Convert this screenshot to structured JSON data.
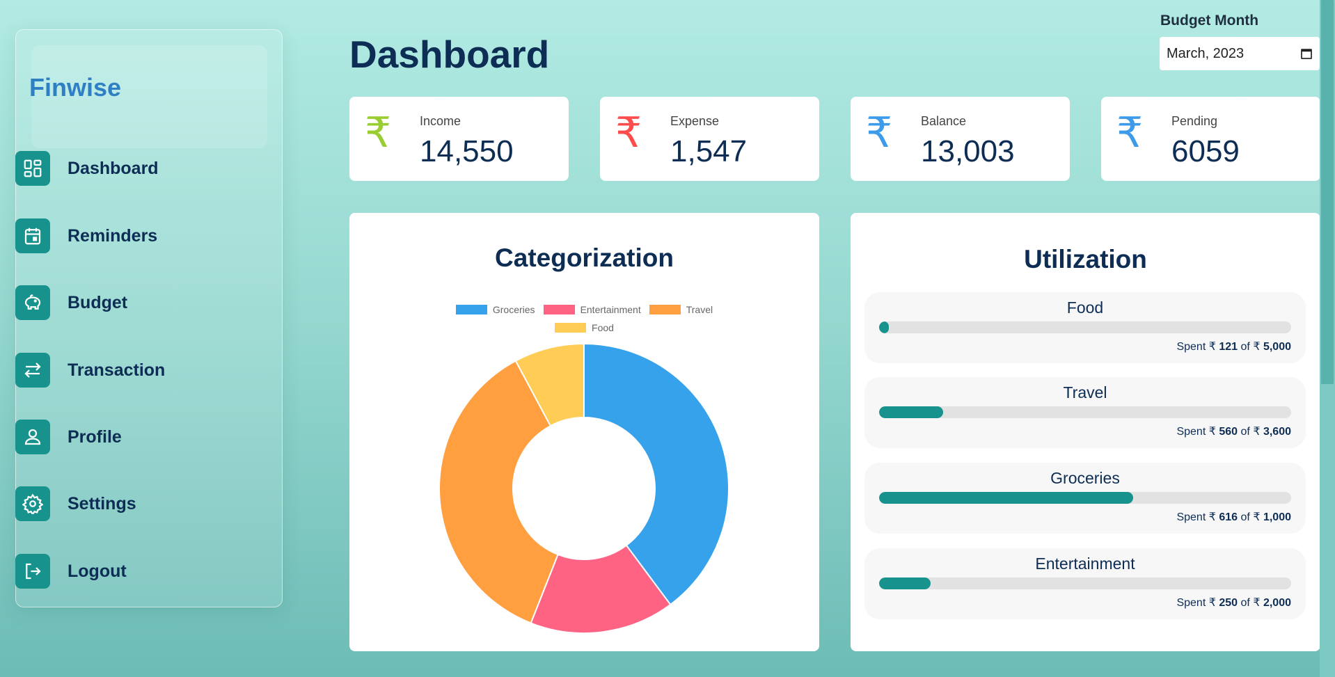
{
  "app": {
    "brand": "Finwise"
  },
  "sidebar": {
    "items": [
      {
        "label": "Dashboard",
        "icon": "dashboard-grid-icon"
      },
      {
        "label": "Reminders",
        "icon": "calendar-icon"
      },
      {
        "label": "Budget",
        "icon": "piggy-bank-icon"
      },
      {
        "label": "Transaction",
        "icon": "transfer-arrows-icon"
      },
      {
        "label": "Profile",
        "icon": "user-icon"
      },
      {
        "label": "Settings",
        "icon": "gear-icon"
      },
      {
        "label": "Logout",
        "icon": "logout-icon"
      }
    ]
  },
  "header": {
    "title": "Dashboard",
    "month_label": "Budget Month",
    "month_value": "March, 2023"
  },
  "stats": [
    {
      "label": "Income",
      "value": "14,550",
      "symbol": "₹",
      "color": "#9acd32"
    },
    {
      "label": "Expense",
      "value": "1,547",
      "symbol": "₹",
      "color": "#ff4d4d"
    },
    {
      "label": "Balance",
      "value": "13,003",
      "symbol": "₹",
      "color": "#3d9be9"
    },
    {
      "label": "Pending",
      "value": "6059",
      "symbol": "₹",
      "color": "#3d9be9"
    }
  ],
  "categorization": {
    "title": "Categorization",
    "chart_data": {
      "type": "pie",
      "categories": [
        "Groceries",
        "Entertainment",
        "Travel",
        "Food"
      ],
      "values": [
        616,
        250,
        560,
        121
      ],
      "colors": [
        "#36a2eb",
        "#ff6384",
        "#ff9f40",
        "#ffcd56"
      ],
      "legend_position": "top"
    }
  },
  "utilization": {
    "title": "Utilization",
    "currency": "₹",
    "items": [
      {
        "name": "Food",
        "spent": "121",
        "budget": "5,000",
        "fraction": 0.0242
      },
      {
        "name": "Travel",
        "spent": "560",
        "budget": "3,600",
        "fraction": 0.1556
      },
      {
        "name": "Groceries",
        "spent": "616",
        "budget": "1,000",
        "fraction": 0.616
      },
      {
        "name": "Entertainment",
        "spent": "250",
        "budget": "2,000",
        "fraction": 0.125
      }
    ],
    "spent_prefix": "Spent",
    "of_word": "of"
  },
  "colors": {
    "accent": "#17928c",
    "navy": "#0d2d54",
    "brand": "#2f7fc4"
  }
}
